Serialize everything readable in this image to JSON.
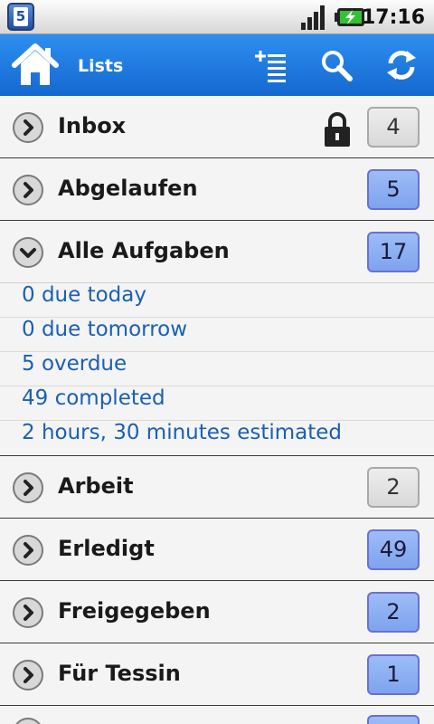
{
  "status_bar": {
    "app_icon_digit": "5",
    "time": "17:16"
  },
  "toolbar": {
    "title": "Lists"
  },
  "lists": [
    {
      "label": "Inbox",
      "count": "4",
      "badge": "gray",
      "locked": true,
      "expanded": false
    },
    {
      "label": "Abgelaufen",
      "count": "5",
      "badge": "blue",
      "locked": false,
      "expanded": false
    },
    {
      "label": "Alle Aufgaben",
      "count": "17",
      "badge": "blue",
      "locked": false,
      "expanded": true,
      "stats": [
        "0 due today",
        "0 due tomorrow",
        "5 overdue",
        "49 completed",
        "2 hours, 30 minutes estimated"
      ]
    },
    {
      "label": "Arbeit",
      "count": "2",
      "badge": "gray",
      "locked": false,
      "expanded": false
    },
    {
      "label": "Erledigt",
      "count": "49",
      "badge": "blue",
      "locked": false,
      "expanded": false
    },
    {
      "label": "Freigegeben",
      "count": "2",
      "badge": "blue",
      "locked": false,
      "expanded": false
    },
    {
      "label": "Für Tessin",
      "count": "1",
      "badge": "blue",
      "locked": false,
      "expanded": false
    }
  ],
  "colors": {
    "toolbar": "#1f7fe6",
    "stat_text": "#1b5fb3",
    "badge_blue": "#8fb0f3",
    "badge_gray": "#e3e3e3"
  },
  "icons": [
    "home-icon",
    "add-list-icon",
    "search-icon",
    "sync-icon",
    "chevron-right-icon",
    "chevron-down-icon",
    "lock-icon"
  ]
}
